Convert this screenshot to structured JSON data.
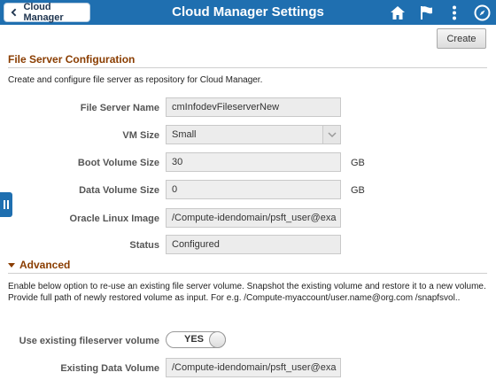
{
  "header": {
    "back_label": "Cloud Manager",
    "title": "Cloud Manager Settings"
  },
  "toolbar": {
    "create_label": "Create"
  },
  "file_server": {
    "section_title": "File Server Configuration",
    "description": "Create and configure file server as repository for Cloud Manager.",
    "fields": {
      "name": {
        "label": "File Server Name",
        "value": "cmInfodevFileserverNew"
      },
      "vm_size": {
        "label": "VM Size",
        "value": "Small"
      },
      "boot_volume": {
        "label": "Boot Volume Size",
        "value": "30",
        "unit": "GB"
      },
      "data_volume": {
        "label": "Data Volume Size",
        "value": "0",
        "unit": "GB"
      },
      "image": {
        "label": "Oracle Linux Image",
        "value": "/Compute-idendomain/psft_user@exa"
      },
      "status": {
        "label": "Status",
        "value": "Configured"
      }
    }
  },
  "advanced": {
    "label": "Advanced",
    "description": "Enable below option to re-use an existing file server volume. Snapshot the existing volume and restore it to a new volume. Provide full path of newly restored volume as input. For e.g. /Compute-myaccount/user.name@org.com /snapfsvol..",
    "use_existing": {
      "label": "Use existing fileserver volume",
      "toggle": "YES"
    },
    "existing_volume": {
      "label": "Existing Data Volume",
      "value": "/Compute-idendomain/psft_user@exa"
    }
  },
  "colors": {
    "header": "#1f6fb0",
    "section": "#8a3d00"
  }
}
